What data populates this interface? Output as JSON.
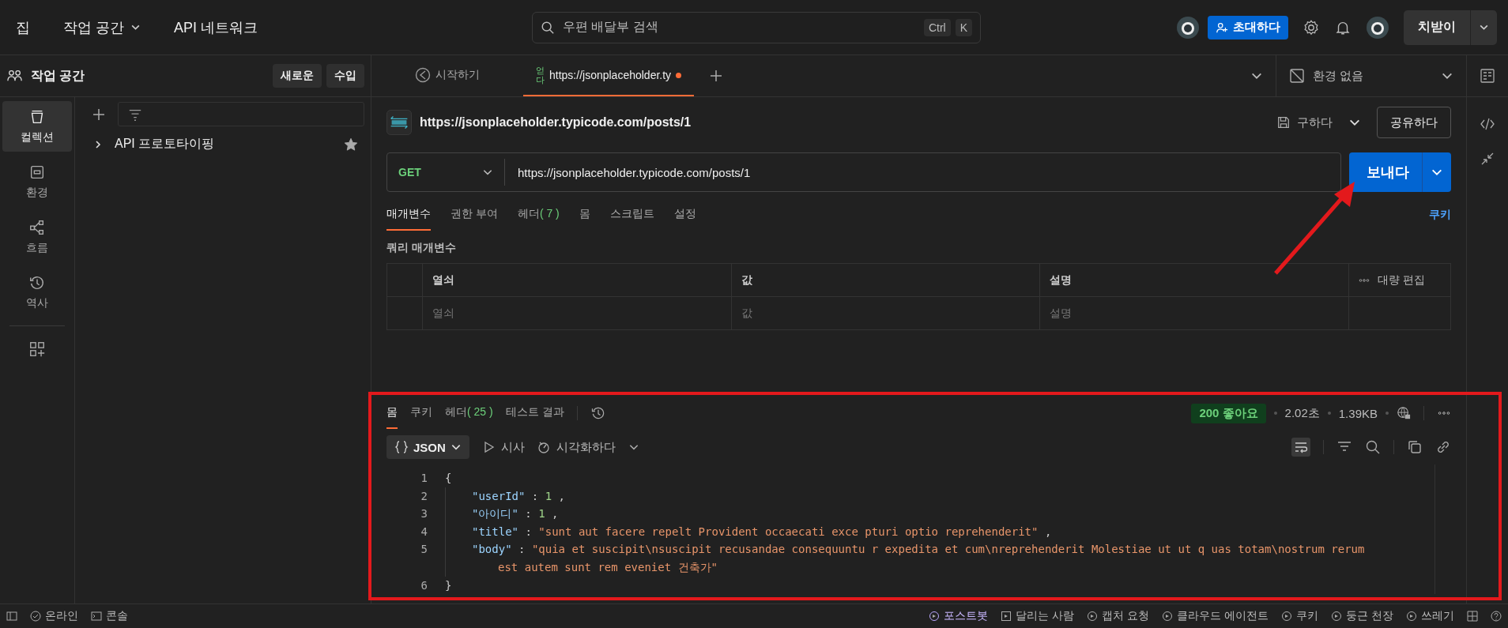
{
  "top_bar": {
    "home": "집",
    "workspace_menu": "작업 공간",
    "api_network": "API 네트워크",
    "search": {
      "placeholder": "우편 배달부 검색",
      "keys": [
        "Ctrl",
        "K"
      ]
    },
    "invite_button": "초대하다",
    "upgrade_button": "치받이"
  },
  "sidebar": {
    "title": "작업 공간",
    "buttons": [
      "새로운",
      "수입"
    ],
    "nav": [
      {
        "label": "컬렉션",
        "selected": true
      },
      {
        "label": "환경",
        "selected": false
      },
      {
        "label": "흐름",
        "selected": false
      },
      {
        "label": "역사",
        "selected": false
      }
    ],
    "collections": [
      {
        "name": "API 프로토타이핑",
        "expanded": false,
        "starred": true
      }
    ]
  },
  "tabs": [
    {
      "kind": "home",
      "label": "시작하기",
      "selected": false,
      "unsaved": false
    },
    {
      "kind": "request",
      "method": "얻다",
      "label": "https://jsonplaceholder.ty",
      "selected": true,
      "unsaved": true
    }
  ],
  "environment": "환경 없음",
  "request": {
    "title": "https://jsonplaceholder.typicode.com/posts/1",
    "save": "구하다",
    "share": "공유하다",
    "method": "GET",
    "url": "https://jsonplaceholder.typicode.com/posts/1",
    "send": "보내다",
    "tabs": [
      {
        "label": "매개변수",
        "selected": true
      },
      {
        "label": "권한 부여",
        "selected": false
      },
      {
        "label": "헤더",
        "count": "( 7 )",
        "selected": false
      },
      {
        "label": "몸",
        "selected": false
      },
      {
        "label": "스크립트",
        "selected": false
      },
      {
        "label": "설정",
        "selected": false
      }
    ],
    "cookies_link": "쿠키",
    "query_title": "쿼리 매개변수",
    "table": {
      "columns": [
        "열쇠",
        "값",
        "설명"
      ],
      "bulk_edit": "대량 편집",
      "placeholders": [
        "열쇠",
        "값",
        "설명"
      ]
    }
  },
  "response": {
    "tabs": [
      {
        "label": "몸",
        "selected": true
      },
      {
        "label": "쿠키",
        "selected": false
      },
      {
        "label": "헤더",
        "count": "( 25 )",
        "selected": false
      },
      {
        "label": "테스트 결과",
        "selected": false
      }
    ],
    "status": "200 좋아요",
    "time": "2.02초",
    "size": "1.39KB",
    "format": "JSON",
    "preview": "시사",
    "visualize": "시각화하다",
    "wrap_lines": true,
    "lines": [
      {
        "number": "1",
        "tokens": [
          {
            "kind": "punct",
            "text": "{"
          }
        ]
      },
      {
        "number": "2",
        "tokens": [
          {
            "kind": "key",
            "text": "\"userId\""
          },
          {
            "kind": "punct",
            "text": " : "
          },
          {
            "kind": "number",
            "text": "1"
          },
          {
            "kind": "punct",
            "text": " ,"
          }
        ]
      },
      {
        "number": "3",
        "tokens": [
          {
            "kind": "key",
            "text": "\"아이디\""
          },
          {
            "kind": "punct",
            "text": " : "
          },
          {
            "kind": "number",
            "text": "1"
          },
          {
            "kind": "punct",
            "text": " ,"
          }
        ]
      },
      {
        "number": "4",
        "tokens": [
          {
            "kind": "key",
            "text": "\"title\""
          },
          {
            "kind": "punct",
            "text": " : "
          },
          {
            "kind": "string",
            "text": "\"sunt aut facere repelt Provident occaecati exce pturi optio reprehenderit\""
          },
          {
            "kind": "punct",
            "text": " ,"
          }
        ]
      },
      {
        "number": "5",
        "tokens": [
          {
            "kind": "key",
            "text": "\"body\""
          },
          {
            "kind": "punct",
            "text": " : "
          },
          {
            "kind": "string",
            "text": "\"quia et suscipit\\nsuscipit recusandae consequuntu r expedita et cum\\nreprehenderit Molestiae ut ut q uas totam\\nostrum rerum"
          }
        ],
        "continuation": [
          {
            "kind": "string",
            "text": "est autem sunt rem eveniet 건축가\""
          }
        ]
      },
      {
        "number": "6",
        "tokens": [
          {
            "kind": "punct",
            "text": "}"
          }
        ]
      }
    ]
  },
  "status_bar": {
    "left": [
      "온라인",
      "콘솔"
    ],
    "right": [
      "포스트봇",
      "달리는 사람",
      "캡처 요청",
      "클라우드 에이전트",
      "쿠키",
      "둥근 천장",
      "쓰레기"
    ]
  }
}
